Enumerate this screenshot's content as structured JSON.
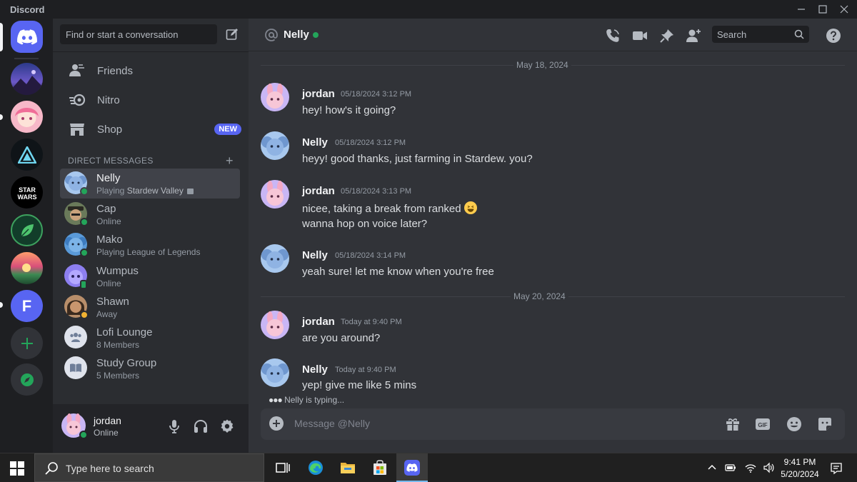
{
  "window": {
    "title": "Discord"
  },
  "sidebar": {
    "search_placeholder": "Find or start a conversation",
    "nav": [
      {
        "label": "Friends"
      },
      {
        "label": "Nitro"
      },
      {
        "label": "Shop",
        "badge": "NEW"
      }
    ],
    "dm_header": "DIRECT MESSAGES",
    "dms": [
      {
        "name": "Nelly",
        "activity_prefix": "Playing ",
        "activity": "Stardew Valley",
        "status": "online"
      },
      {
        "name": "Cap",
        "sub": "Online",
        "status": "online"
      },
      {
        "name": "Mako",
        "sub": "Playing League of Legends",
        "status": "online"
      },
      {
        "name": "Wumpus",
        "sub": "Online",
        "status": "mobile"
      },
      {
        "name": "Shawn",
        "sub": "Away",
        "status": "idle"
      },
      {
        "name": "Lofi Lounge",
        "sub": "8 Members"
      },
      {
        "name": "Study Group",
        "sub": "5 Members"
      }
    ]
  },
  "user": {
    "name": "jordan",
    "status": "Online"
  },
  "chat": {
    "channel": "Nelly",
    "search_placeholder": "Search",
    "dividers": [
      "May 18, 2024",
      "May 20, 2024"
    ],
    "messages": [
      {
        "author": "jordan",
        "time": "05/18/2024 3:12 PM",
        "lines": [
          "hey! how's it going?"
        ]
      },
      {
        "author": "Nelly",
        "time": "05/18/2024 3:12 PM",
        "lines": [
          "heyy! good thanks, just farming in Stardew. you?"
        ]
      },
      {
        "author": "jordan",
        "time": "05/18/2024 3:13 PM",
        "lines": [
          "nicee, taking a break from ranked",
          "wanna hop on voice later?"
        ]
      },
      {
        "author": "Nelly",
        "time": "05/18/2024 3:14 PM",
        "lines": [
          "yeah sure! let me know when you're free"
        ]
      },
      {
        "author": "jordan",
        "time": "Today at 9:40 PM",
        "lines": [
          "are you around?"
        ]
      },
      {
        "author": "Nelly",
        "time": "Today at 9:40 PM",
        "lines": [
          "yep! give me like 5 mins"
        ]
      }
    ],
    "typing": "Nelly is typing...",
    "composer_placeholder": "Message @Nelly"
  },
  "taskbar": {
    "search_placeholder": "Type here to search",
    "time": "9:41 PM",
    "date": "5/20/2024"
  },
  "colors": {
    "blurple": "#5865f2",
    "online": "#23a55a",
    "idle": "#f0b232",
    "background": "#313338"
  }
}
